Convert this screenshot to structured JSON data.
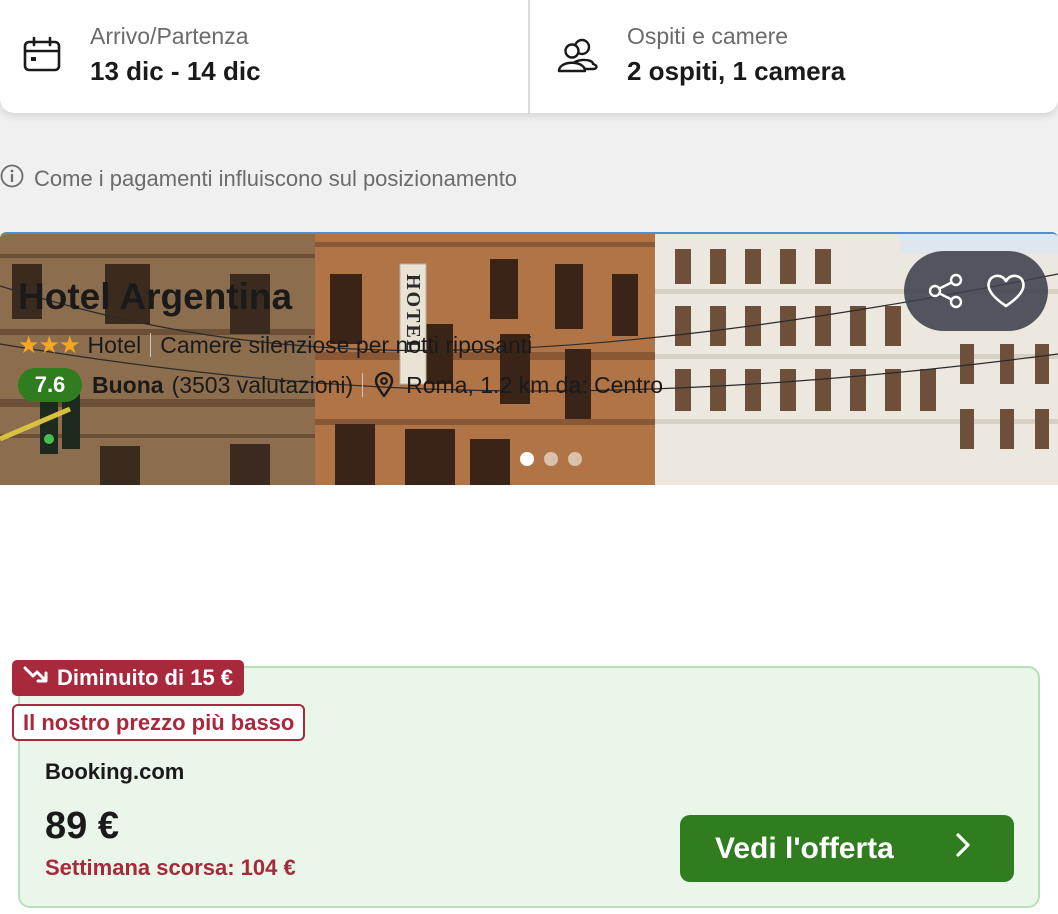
{
  "search": {
    "dates_label": "Arrivo/Partenza",
    "dates_value": "13 dic - 14 dic",
    "guests_label": "Ospiti e camere",
    "guests_value": "2 ospiti, 1 camera"
  },
  "payment_info": {
    "text": "Come i pagamenti influiscono sul posizionamento"
  },
  "hotel": {
    "photo_sign": "HOTEL",
    "photo_count": 4,
    "active_photo": 1,
    "name": "Hotel Argentina",
    "stars": "★★★",
    "star_count": 3,
    "type": "Hotel",
    "tagline": "Camere silenziose per notti riposanti",
    "score": "7.6",
    "rating_word": "Buona",
    "reviews": "(3503 valutazioni)",
    "location": "Roma, 1.2 km da: Centro"
  },
  "deal": {
    "drop_badge": "Diminuito di 15 €",
    "lowest_badge": "Il nostro prezzo più basso",
    "provider": "Booking.com",
    "price": "89 €",
    "last_week": "Settimana scorsa: 104 €",
    "cta": "Vedi l'offerta"
  },
  "colors": {
    "brand_green": "#2f7d1f",
    "deal_red": "#a8283c",
    "deal_bg": "#eaf6ea",
    "star": "#f5a623"
  }
}
